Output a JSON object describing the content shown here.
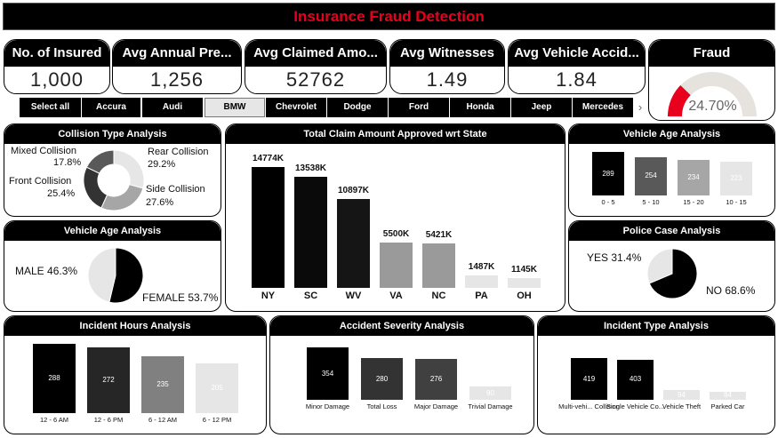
{
  "title": "Insurance Fraud Detection",
  "kpis": [
    {
      "label": "No. of Insured",
      "value": "1,000"
    },
    {
      "label": "Avg Annual Pre...",
      "value": "1,256"
    },
    {
      "label": "Avg Claimed Amo...",
      "value": "52762"
    },
    {
      "label": "Avg Witnesses",
      "value": "1.49"
    },
    {
      "label": "Avg Vehicle Accid...",
      "value": "1.84"
    }
  ],
  "fraud": {
    "label": "Fraud",
    "value": "24.70%",
    "percent": 24.7
  },
  "slicer": {
    "items": [
      "Select all",
      "Accura",
      "Audi",
      "BMW",
      "Chevrolet",
      "Dodge",
      "Ford",
      "Honda",
      "Jeep",
      "Mercedes"
    ],
    "selected": "BMW",
    "next_icon": "chevron-right-icon"
  },
  "collision": {
    "title": "Collision Type Analysis",
    "slices": [
      {
        "name": "Mixed Collision",
        "pct": "17.8%",
        "value": 17.8,
        "color": "#595959"
      },
      {
        "name": "Rear Collision",
        "pct": "29.2%",
        "value": 29.2,
        "color": "#e6e6e6"
      },
      {
        "name": "Side Collision",
        "pct": "27.6%",
        "value": 27.6,
        "color": "#a6a6a6"
      },
      {
        "name": "Front Collision",
        "pct": "25.4%",
        "value": 25.4,
        "color": "#333333"
      }
    ]
  },
  "gender": {
    "title": "Vehicle Age Analysis",
    "slices": [
      {
        "name": "MALE",
        "pct": "46.3%",
        "value": 46.3,
        "color": "#e6e6e6"
      },
      {
        "name": "FEMALE",
        "pct": "53.7%",
        "value": 53.7,
        "color": "#000000"
      }
    ]
  },
  "state_claims": {
    "title": "Total Claim Amount Approved wrt State",
    "bars": [
      {
        "cat": "NY",
        "label": "14774K",
        "value": 14774,
        "color": "#000000"
      },
      {
        "cat": "SC",
        "label": "13538K",
        "value": 13538,
        "color": "#0a0a0a"
      },
      {
        "cat": "WV",
        "label": "10897K",
        "value": 10897,
        "color": "#151515"
      },
      {
        "cat": "VA",
        "label": "5500K",
        "value": 5500,
        "color": "#9a9a9a"
      },
      {
        "cat": "NC",
        "label": "5421K",
        "value": 5421,
        "color": "#9a9a9a"
      },
      {
        "cat": "PA",
        "label": "1487K",
        "value": 1487,
        "color": "#e6e6e6"
      },
      {
        "cat": "OH",
        "label": "1145K",
        "value": 1145,
        "color": "#e6e6e6"
      }
    ]
  },
  "vehicle_age": {
    "title": "Vehicle Age Analysis",
    "bars": [
      {
        "cat": "0 - 5",
        "label": "289",
        "value": 289,
        "color": "#000000",
        "text": "#ffffff"
      },
      {
        "cat": "5 - 10",
        "label": "254",
        "value": 254,
        "color": "#595959",
        "text": "#ffffff"
      },
      {
        "cat": "15 - 20",
        "label": "234",
        "value": 234,
        "color": "#a6a6a6",
        "text": "#ffffff"
      },
      {
        "cat": "10 - 15",
        "label": "223",
        "value": 223,
        "color": "#e6e6e6",
        "text": "#ffffff"
      }
    ]
  },
  "police": {
    "title": "Police Case Analysis",
    "slices": [
      {
        "name": "YES",
        "pct": "31.4%",
        "value": 31.4,
        "color": "#e6e6e6"
      },
      {
        "name": "NO",
        "pct": "68.6%",
        "value": 68.6,
        "color": "#000000"
      }
    ]
  },
  "incident_hours": {
    "title": "Incident Hours Analysis",
    "bars": [
      {
        "cat": "12 - 6 AM",
        "label": "288",
        "value": 288,
        "color": "#000000",
        "text": "#ffffff"
      },
      {
        "cat": "12 - 6 PM",
        "label": "272",
        "value": 272,
        "color": "#262626",
        "text": "#ffffff"
      },
      {
        "cat": "6 - 12 AM",
        "label": "235",
        "value": 235,
        "color": "#808080",
        "text": "#ffffff"
      },
      {
        "cat": "6 - 12 PM",
        "label": "205",
        "value": 205,
        "color": "#e6e6e6",
        "text": "#ffffff"
      }
    ]
  },
  "severity": {
    "title": "Accident Severity Analysis",
    "bars": [
      {
        "cat": "Minor Damage",
        "label": "354",
        "value": 354,
        "color": "#000000",
        "text": "#ffffff"
      },
      {
        "cat": "Total Loss",
        "label": "280",
        "value": 280,
        "color": "#333333",
        "text": "#ffffff"
      },
      {
        "cat": "Major Damage",
        "label": "276",
        "value": 276,
        "color": "#404040",
        "text": "#ffffff"
      },
      {
        "cat": "Trivial Damage",
        "label": "90",
        "value": 90,
        "color": "#e6e6e6",
        "text": "#ffffff"
      }
    ]
  },
  "incident_type": {
    "title": "Incident Type Analysis",
    "bars": [
      {
        "cat": "Multi-vehi... Collision",
        "label": "419",
        "value": 419,
        "color": "#000000",
        "text": "#ffffff"
      },
      {
        "cat": "Single Vehicle Co...",
        "label": "403",
        "value": 403,
        "color": "#000000",
        "text": "#ffffff"
      },
      {
        "cat": "Vehicle Theft",
        "label": "94",
        "value": 94,
        "color": "#e6e6e6",
        "text": "#ffffff"
      },
      {
        "cat": "Parked Car",
        "label": "84",
        "value": 84,
        "color": "#e6e6e6",
        "text": "#ffffff"
      }
    ]
  }
}
